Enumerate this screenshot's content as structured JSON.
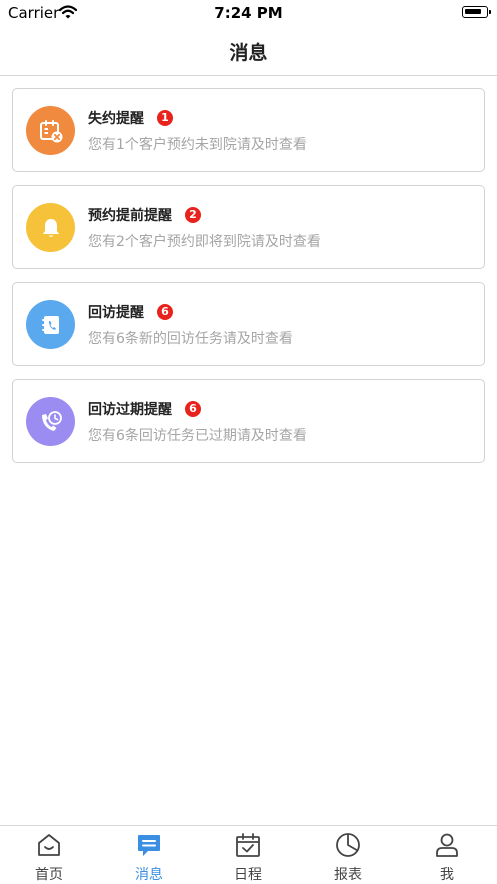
{
  "status_bar": {
    "carrier": "Carrier",
    "time": "7:24 PM"
  },
  "header": {
    "title": "消息"
  },
  "messages": [
    {
      "title": "失约提醒",
      "badge": "1",
      "description": "您有1个客户预约未到院请及时查看",
      "icon": "calendar-cancel-icon",
      "color": "#ef8a3f"
    },
    {
      "title": "预约提前提醒",
      "badge": "2",
      "description": "您有2个客户预约即将到院请及时查看",
      "icon": "bell-icon",
      "color": "#f5c23a"
    },
    {
      "title": "回访提醒",
      "badge": "6",
      "description": "您有6条新的回访任务请及时查看",
      "icon": "phone-book-icon",
      "color": "#5aa8ee"
    },
    {
      "title": "回访过期提醒",
      "badge": "6",
      "description": "您有6条回访任务已过期请及时查看",
      "icon": "phone-clock-icon",
      "color": "#9a8cf0"
    }
  ],
  "tabs": [
    {
      "label": "首页",
      "icon": "home-icon",
      "active": false
    },
    {
      "label": "消息",
      "icon": "message-icon",
      "active": true
    },
    {
      "label": "日程",
      "icon": "calendar-check-icon",
      "active": false
    },
    {
      "label": "报表",
      "icon": "pie-chart-icon",
      "active": false
    },
    {
      "label": "我",
      "icon": "user-icon",
      "active": false
    }
  ],
  "colors": {
    "active": "#3b8fe2",
    "inactive": "#444444",
    "badge": "#e8231d"
  }
}
